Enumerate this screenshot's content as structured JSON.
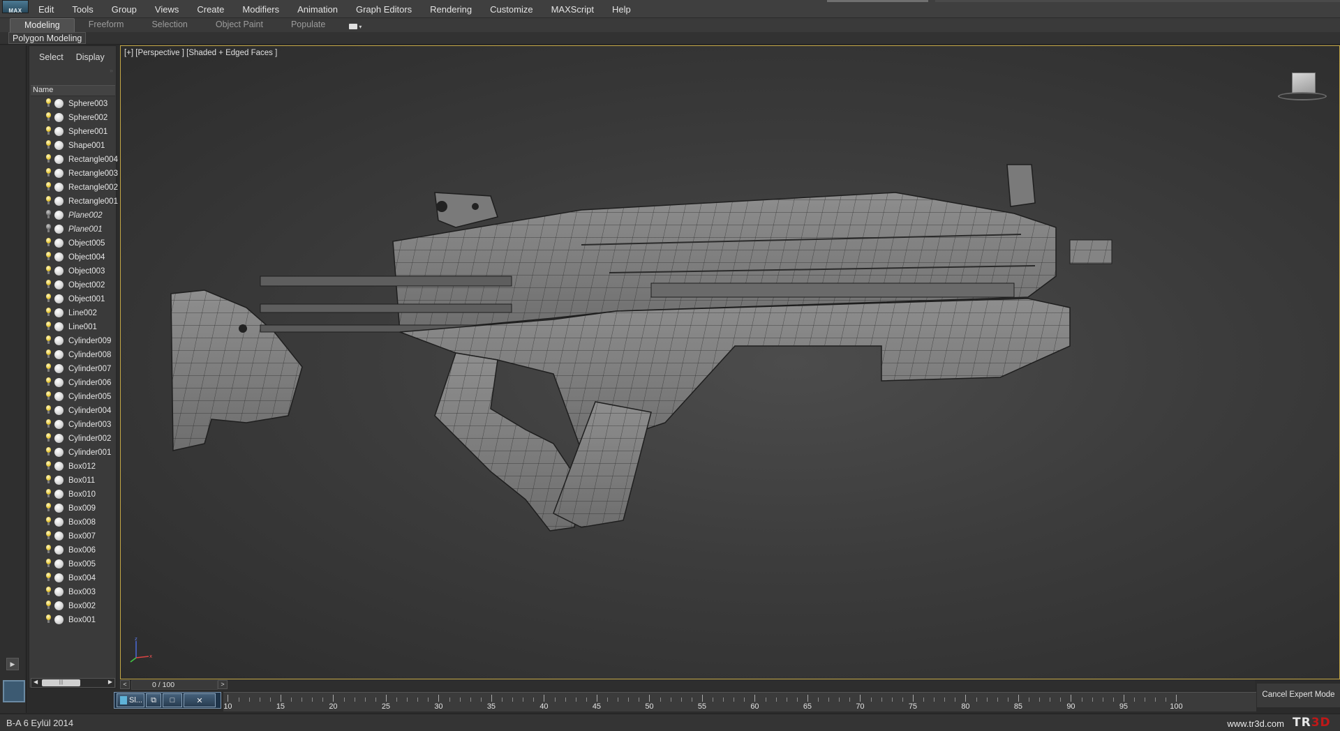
{
  "app": {
    "logo_text": "MAX"
  },
  "menu": [
    "Edit",
    "Tools",
    "Group",
    "Views",
    "Create",
    "Modifiers",
    "Animation",
    "Graph Editors",
    "Rendering",
    "Customize",
    "MAXScript",
    "Help"
  ],
  "ribbon": {
    "tabs": [
      "Modeling",
      "Freeform",
      "Selection",
      "Object Paint",
      "Populate"
    ],
    "active_tab": "Modeling",
    "panel_label": "Polygon Modeling"
  },
  "explorer": {
    "tabs": [
      "Select",
      "Display"
    ],
    "column_header": "Name",
    "items": [
      {
        "name": "Sphere003",
        "hidden": false
      },
      {
        "name": "Sphere002",
        "hidden": false
      },
      {
        "name": "Sphere001",
        "hidden": false
      },
      {
        "name": "Shape001",
        "hidden": false
      },
      {
        "name": "Rectangle004",
        "hidden": false
      },
      {
        "name": "Rectangle003",
        "hidden": false
      },
      {
        "name": "Rectangle002",
        "hidden": false
      },
      {
        "name": "Rectangle001",
        "hidden": false
      },
      {
        "name": "Plane002",
        "hidden": true
      },
      {
        "name": "Plane001",
        "hidden": true
      },
      {
        "name": "Object005",
        "hidden": false
      },
      {
        "name": "Object004",
        "hidden": false
      },
      {
        "name": "Object003",
        "hidden": false
      },
      {
        "name": "Object002",
        "hidden": false
      },
      {
        "name": "Object001",
        "hidden": false
      },
      {
        "name": "Line002",
        "hidden": false
      },
      {
        "name": "Line001",
        "hidden": false
      },
      {
        "name": "Cylinder009",
        "hidden": false
      },
      {
        "name": "Cylinder008",
        "hidden": false
      },
      {
        "name": "Cylinder007",
        "hidden": false
      },
      {
        "name": "Cylinder006",
        "hidden": false
      },
      {
        "name": "Cylinder005",
        "hidden": false
      },
      {
        "name": "Cylinder004",
        "hidden": false
      },
      {
        "name": "Cylinder003",
        "hidden": false
      },
      {
        "name": "Cylinder002",
        "hidden": false
      },
      {
        "name": "Cylinder001",
        "hidden": false
      },
      {
        "name": "Box012",
        "hidden": false
      },
      {
        "name": "Box011",
        "hidden": false
      },
      {
        "name": "Box010",
        "hidden": false
      },
      {
        "name": "Box009",
        "hidden": false
      },
      {
        "name": "Box008",
        "hidden": false
      },
      {
        "name": "Box007",
        "hidden": false
      },
      {
        "name": "Box006",
        "hidden": false
      },
      {
        "name": "Box005",
        "hidden": false
      },
      {
        "name": "Box004",
        "hidden": false
      },
      {
        "name": "Box003",
        "hidden": false
      },
      {
        "name": "Box002",
        "hidden": false
      },
      {
        "name": "Box001",
        "hidden": false
      }
    ]
  },
  "viewport": {
    "label": "[+] [Perspective ] [Shaded + Edged Faces ]",
    "border_color": "#c5a846"
  },
  "timeline": {
    "frame_display": "0 / 100",
    "prev": "<",
    "next": ">",
    "ruler_labels": [
      10,
      15,
      20,
      25,
      30,
      35,
      40,
      45,
      50,
      55,
      60,
      65,
      70,
      75,
      80,
      85,
      90,
      95,
      100
    ]
  },
  "taskbar": {
    "window_label": "Sl..."
  },
  "cancel_expert_mode": "Cancel Expert Mode",
  "status": {
    "left_text": "B-A 6 Eylül 2014",
    "right_text": "www.tr3d.com",
    "logo_left": "TR",
    "logo_right": "3D"
  }
}
